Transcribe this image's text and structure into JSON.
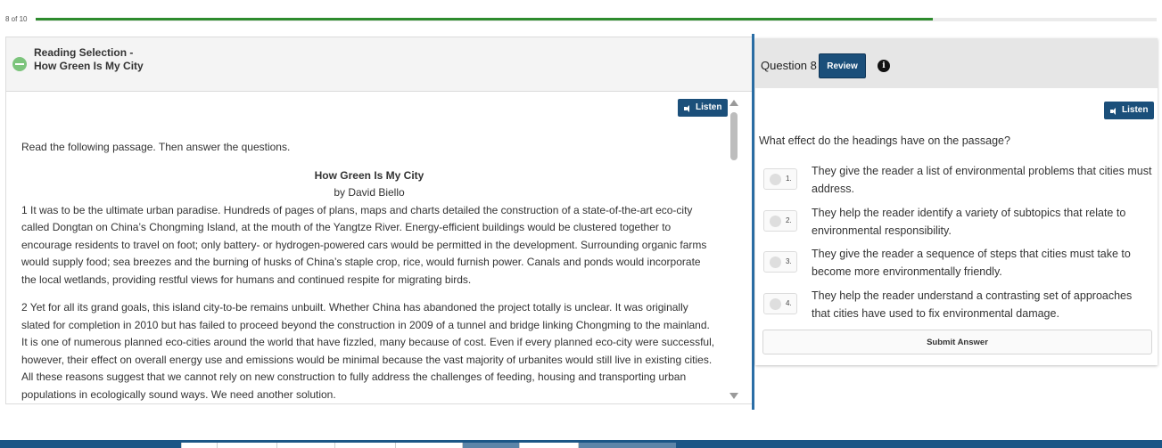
{
  "progress": {
    "label": "8 of 10",
    "fraction": 0.8,
    "color": "#2e8b2e"
  },
  "reading": {
    "header_line1": "Reading Selection -",
    "header_line2": "How Green Is My City",
    "listen_label": "Listen",
    "instructions": "Read the following passage. Then answer the questions.",
    "title": "How Green Is My City",
    "author": "by David Biello",
    "paragraphs": [
      "1 It was to be the ultimate urban paradise. Hundreds of pages of plans, maps and charts detailed the construction of a state-of-the-art eco-city called Dongtan on China’s Chongming Island, at the mouth of the Yangtze River. Energy-efficient buildings would be clustered together to encourage residents to travel on foot; only battery- or hydrogen-powered cars would be permitted in the development. Surrounding organic farms would supply food; sea breezes and the burning of husks of China’s staple crop, rice, would furnish power. Canals and ponds would incorporate the local wetlands, providing restful views for humans and continued respite for migrating birds.",
      "2 Yet for all its grand goals, this island city-to-be remains unbuilt. Whether China has abandoned the project totally is unclear. It was originally slated for completion in 2010 but has failed to proceed beyond the construction in 2009 of a tunnel and bridge linking Chongming to the mainland. It is one of numerous planned eco-cities around the world that have fizzled, many because of cost. Even if every planned eco-city were successful, however, their effect on overall energy use and emissions would be minimal because the vast majority of urbanites would still live in existing cities. All these reasons suggest that we cannot rely on new construction to fully address the challenges of feeding, housing and transporting urban populations in ecologically sound ways. We need another solution."
    ]
  },
  "question": {
    "label": "Question 8",
    "review_label": "Review",
    "info_glyph": "i",
    "listen_label": "Listen",
    "text": "What effect do the headings have on the passage?",
    "options": [
      {
        "num": "1.",
        "text": "They give the reader a list of environmental problems that cities must address."
      },
      {
        "num": "2.",
        "text": "They help the reader identify a variety of subtopics that relate to environmental responsibility."
      },
      {
        "num": "3.",
        "text": "They give the reader a sequence of steps that cities must take to become more environmentally friendly."
      },
      {
        "num": "4.",
        "text": "They help the reader understand a contrasting set of approaches that cities have used to fix environmental damage."
      }
    ],
    "submit_label": "Submit Answer"
  },
  "colors": {
    "primary": "#1b4f7a",
    "divider": "#2b6ea6",
    "bottom_bar": "#1b5686"
  },
  "icons": {
    "collapse": "minus-circle-icon",
    "speaker": "speaker-icon",
    "info": "info-icon"
  }
}
